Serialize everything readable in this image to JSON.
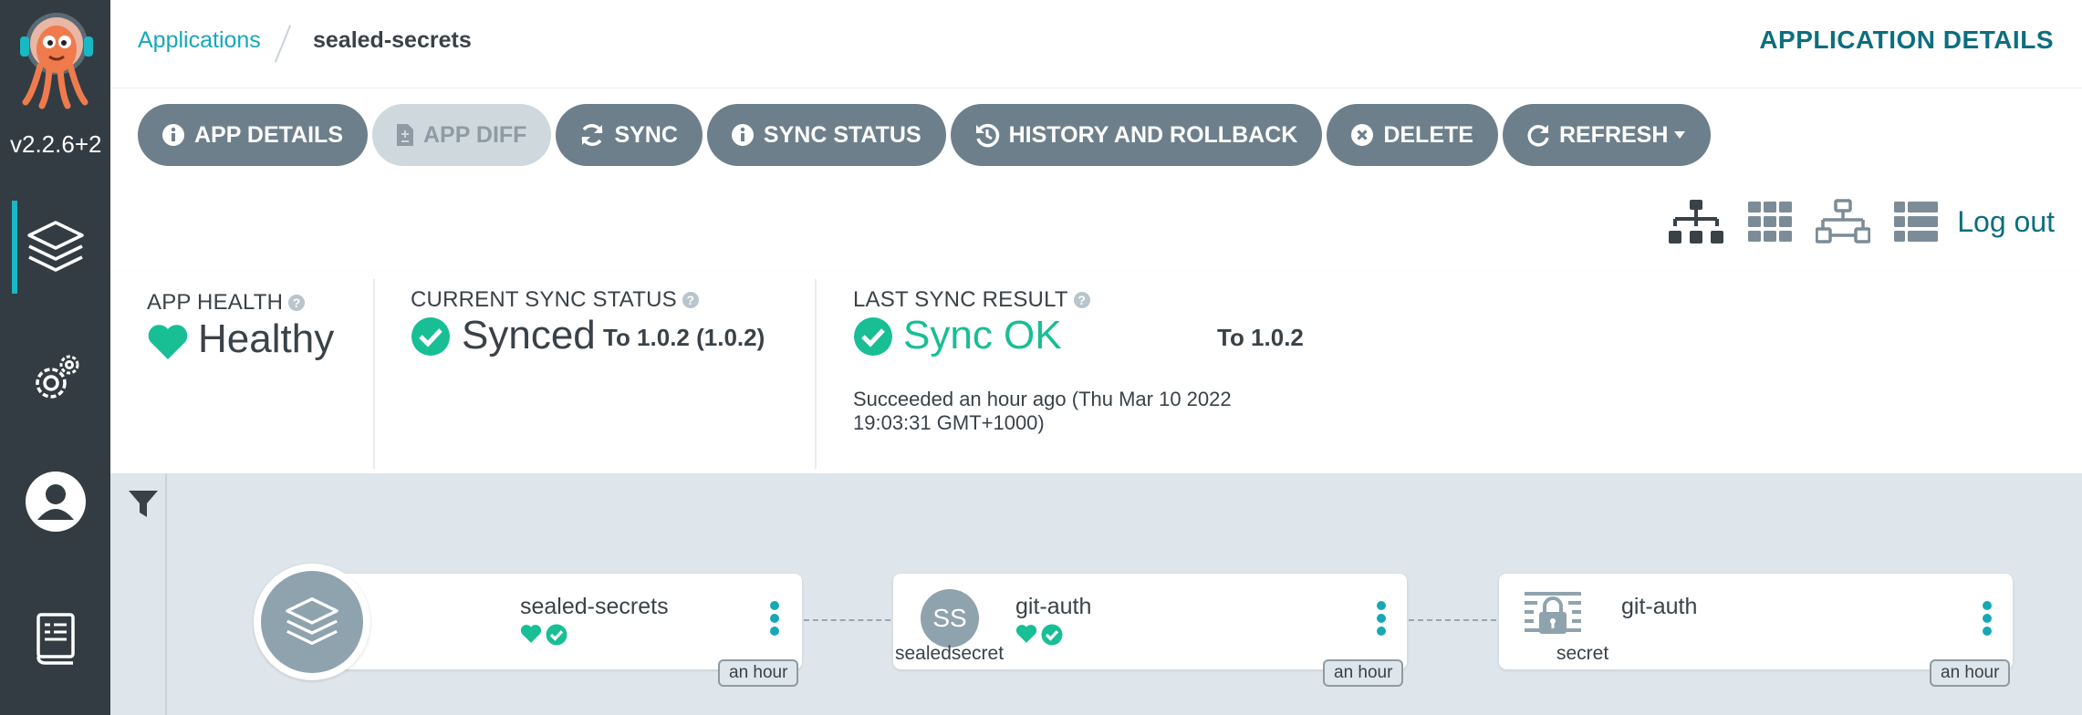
{
  "app": {
    "version": "v2.2.6+2"
  },
  "sidebar": {
    "items": [
      {
        "name": "applications",
        "icon": "layers-icon",
        "active": true
      },
      {
        "name": "settings",
        "icon": "gears-icon",
        "active": false
      },
      {
        "name": "user-info",
        "icon": "user-icon",
        "active": false
      },
      {
        "name": "documentation",
        "icon": "docs-icon",
        "active": false
      }
    ]
  },
  "header": {
    "breadcrumb_root": "Applications",
    "breadcrumb_current": "sealed-secrets",
    "title": "APPLICATION DETAILS"
  },
  "toolbar": {
    "app_details": "APP DETAILS",
    "app_diff": "APP DIFF",
    "sync": "SYNC",
    "sync_status": "SYNC STATUS",
    "history": "HISTORY AND ROLLBACK",
    "delete": "DELETE",
    "refresh": "REFRESH"
  },
  "views": {
    "icons": [
      "tree-view-icon",
      "pods-view-icon",
      "network-view-icon",
      "list-view-icon"
    ],
    "logout": "Log out"
  },
  "status": {
    "health_label": "APP HEALTH",
    "health_value": "Healthy",
    "sync_label": "CURRENT SYNC STATUS",
    "sync_value": "Synced",
    "sync_revision": "To 1.0.2 (1.0.2)",
    "last_label": "LAST SYNC RESULT",
    "last_value": "Sync OK",
    "last_revision": "To 1.0.2",
    "last_note_line1": "Succeeded an hour ago (Thu Mar 10 2022",
    "last_note_line2": "19:03:31 GMT+1000)"
  },
  "graph": {
    "nodes": [
      {
        "name": "sealed-secrets",
        "kind": "",
        "age": "an hour",
        "icon": "application-icon"
      },
      {
        "name": "git-auth",
        "kind": "sealedsecret",
        "badge": "SS",
        "age": "an hour",
        "icon": "sealedsecret-icon"
      },
      {
        "name": "git-auth",
        "kind": "secret",
        "age": "an hour",
        "icon": "secret-icon"
      }
    ]
  },
  "colors": {
    "sidebar": "#333c42",
    "accent": "#18a8b5",
    "healthy": "#18be94",
    "button": "#6d7f8b",
    "title": "#0c6e7f"
  }
}
